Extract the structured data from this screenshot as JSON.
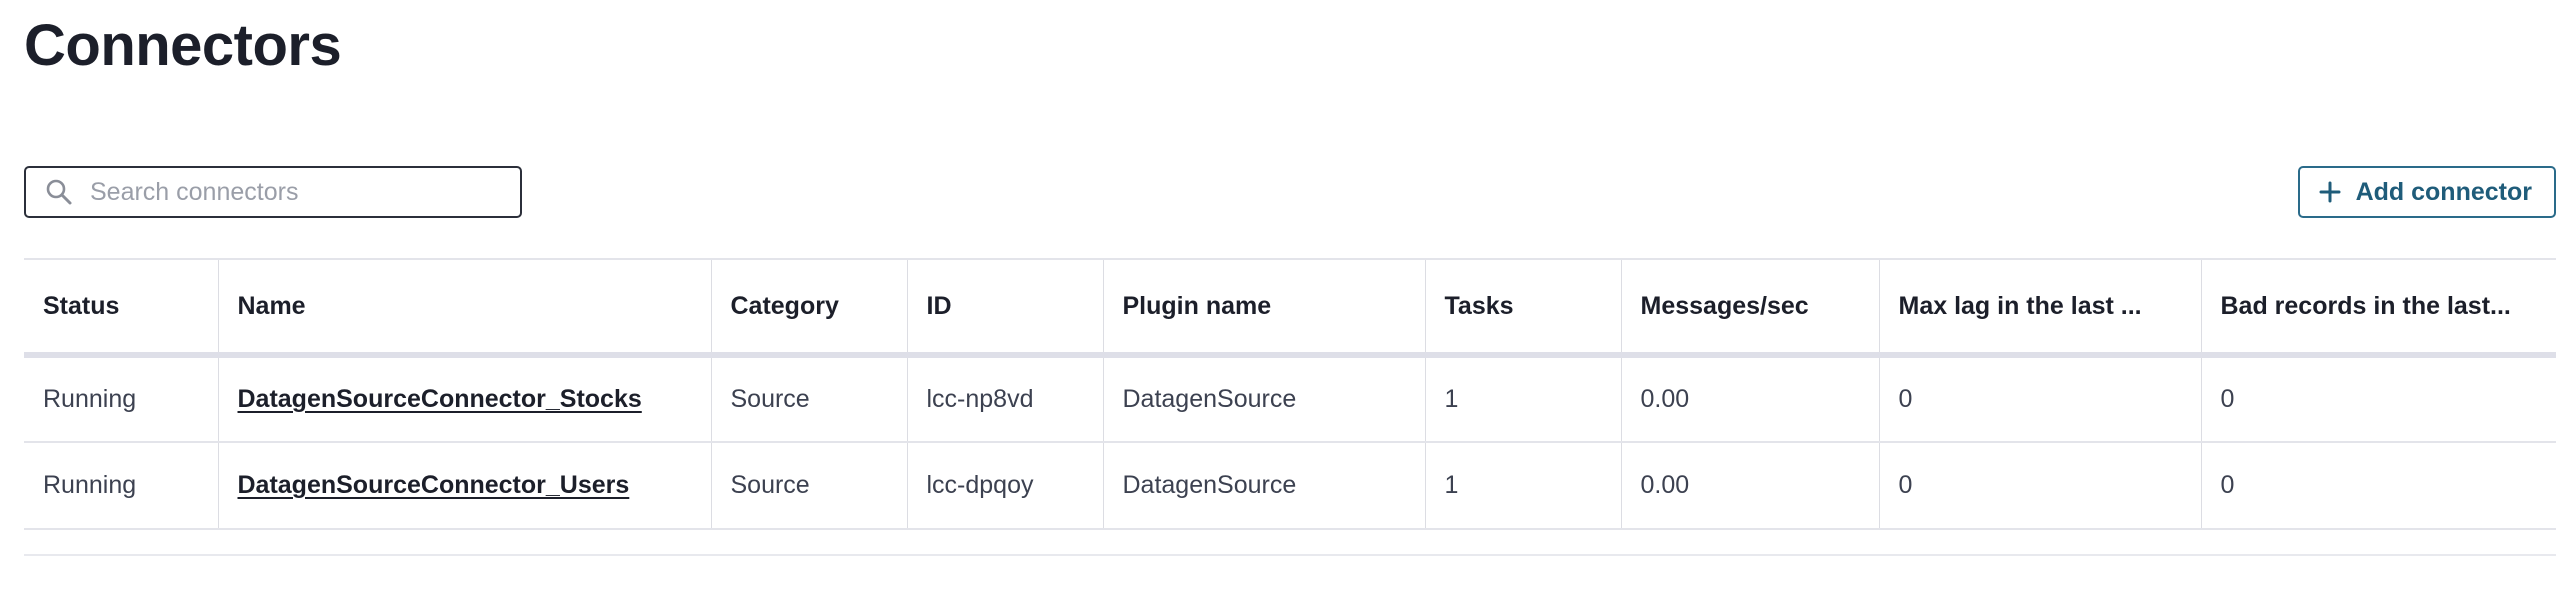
{
  "page": {
    "title": "Connectors"
  },
  "search": {
    "placeholder": "Search connectors",
    "icon": "search-icon"
  },
  "toolbar": {
    "add_label": "Add connector",
    "add_icon": "plus-icon",
    "accent": "#1f5c7a"
  },
  "table": {
    "columns": [
      "Status",
      "Name",
      "Category",
      "ID",
      "Plugin name",
      "Tasks",
      "Messages/sec",
      "Max lag in the last ...",
      "Bad records in the last..."
    ],
    "rows": [
      {
        "status": "Running",
        "name": "DatagenSourceConnector_Stocks",
        "category": "Source",
        "id": "lcc-np8vd",
        "plugin": "DatagenSource",
        "tasks": "1",
        "messages_per_sec": "0.00",
        "max_lag": "0",
        "bad_records": "0"
      },
      {
        "status": "Running",
        "name": "DatagenSourceConnector_Users",
        "category": "Source",
        "id": "lcc-dpqoy",
        "plugin": "DatagenSource",
        "tasks": "1",
        "messages_per_sec": "0.00",
        "max_lag": "0",
        "bad_records": "0"
      }
    ]
  }
}
